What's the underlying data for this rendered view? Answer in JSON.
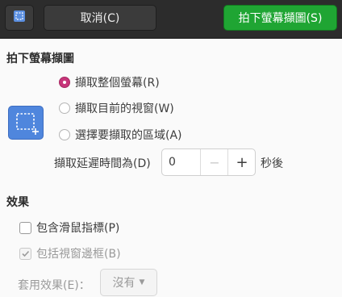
{
  "header": {
    "app_icon": "screenshot-app-icon",
    "cancel_label": "取消(C)",
    "take_label": "拍下螢幕擷圖(S)",
    "take_color": "#1fa533"
  },
  "capture": {
    "title": "拍下螢幕擷圖",
    "icon": "selection-area-icon",
    "options": [
      {
        "label": "擷取整個螢幕(R)",
        "selected": true
      },
      {
        "label": "擷取目前的視窗(W)",
        "selected": false
      },
      {
        "label": "選擇要擷取的區域(A)",
        "selected": false
      }
    ],
    "delay_label": "擷取延遲時間為(D)",
    "delay_value": "0",
    "seconds_label": "秒後"
  },
  "effects": {
    "title": "效果",
    "include_pointer": {
      "label": "包含滑鼠指標(P)",
      "checked": false
    },
    "include_border": {
      "label": "包括視窗邊框(B)",
      "checked": true,
      "disabled": true
    },
    "apply_effect_label": "套用效果(E)：",
    "apply_effect_value": "沒有"
  },
  "colors": {
    "accent_radio": "#c7357a",
    "icon_blue": "#4f86dd"
  }
}
